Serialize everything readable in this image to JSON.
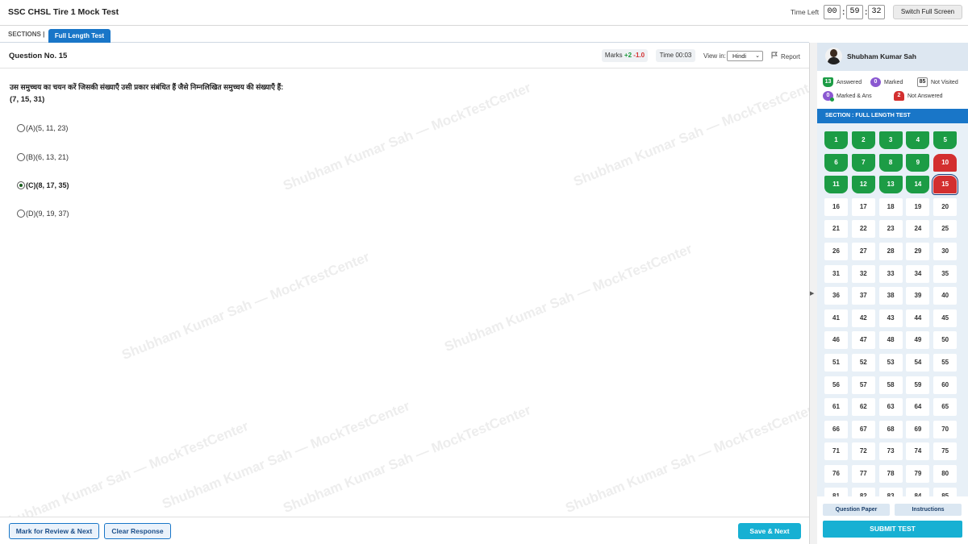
{
  "header": {
    "title": "SSC CHSL Tire 1 Mock Test",
    "time_left_label": "Time Left",
    "timer": {
      "hh": "00",
      "mm": "59",
      "ss": "32",
      "sep": ":"
    },
    "fullscreen_label": "Switch Full Screen"
  },
  "sections": {
    "label": "SECTIONS |",
    "active_tab": "Full Length Test"
  },
  "question": {
    "number_label": "Question No. 15",
    "marks_label": "Marks",
    "marks_positive": "+2",
    "marks_negative": "-1.0",
    "time_label": "Time 00:03",
    "view_in_label": "View in:",
    "language": "Hindi",
    "report_label": "Report",
    "text": "उस समुच्चय का चयन करें जिसकी संख्याएँ उसी प्रकार संबंधित हैं जैसे निम्नलिखित समुच्चय की संख्याएँ हैं:",
    "series": "(7, 15, 31)",
    "options": [
      {
        "label": "(A)(5, 11, 23)",
        "selected": false
      },
      {
        "label": "(B)(6, 13, 21)",
        "selected": false
      },
      {
        "label": "(C)(8, 17, 35)",
        "selected": true
      },
      {
        "label": "(D)(9, 19, 37)",
        "selected": false
      }
    ]
  },
  "watermark": "Shubham Kumar Sah — MockTestCenter",
  "footer": {
    "mark_review_label": "Mark for Review & Next",
    "clear_label": "Clear Response",
    "save_next_label": "Save & Next"
  },
  "panel": {
    "user_name": "Shubham Kumar Sah",
    "legend": {
      "answered": {
        "count": "13",
        "label": "Answered"
      },
      "marked": {
        "count": "0",
        "label": "Marked"
      },
      "not_visited": {
        "count": "85",
        "label": "Not Visited"
      },
      "marked_answered": {
        "count": "0",
        "label": "Marked & Ans"
      },
      "not_answered": {
        "count": "2",
        "label": "Not Answered"
      }
    },
    "section_title": "SECTION : FULL LENGTH TEST",
    "total_visible_questions": 85,
    "answered": [
      1,
      2,
      3,
      4,
      5,
      6,
      7,
      8,
      9,
      11,
      12,
      13,
      14
    ],
    "not_answered": [
      10,
      15
    ],
    "current": 15,
    "question_paper_label": "Question Paper",
    "instructions_label": "Instructions",
    "submit_label": "SUBMIT TEST"
  },
  "colors": {
    "primary": "#1976c8",
    "accent": "#17b0d3",
    "answered": "#1c9c45",
    "not_answered": "#d32f2f",
    "marked": "#8a58d1"
  }
}
